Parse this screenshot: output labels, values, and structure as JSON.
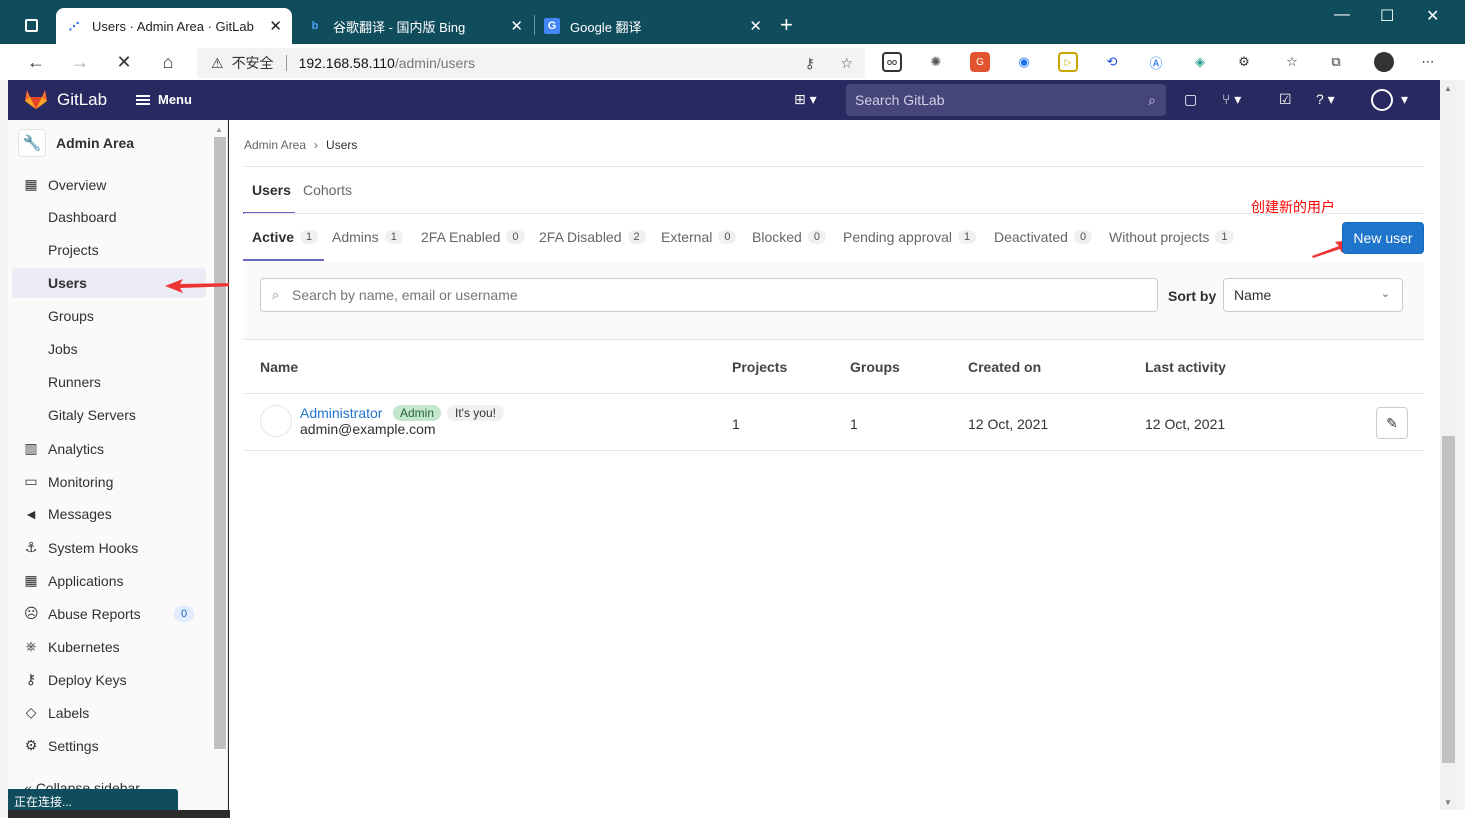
{
  "browser": {
    "tabs": [
      {
        "title": "Users · Admin Area · GitLab",
        "icon": "loading-icon"
      },
      {
        "title": "谷歌翻译 - 国内版 Bing",
        "icon": "bing-icon"
      },
      {
        "title": "Google 翻译",
        "icon": "google-translate-icon"
      }
    ],
    "address": {
      "security": "不安全",
      "host": "192.168.58.110",
      "path": "/admin/users"
    },
    "status": "正在连接..."
  },
  "header": {
    "brand": "GitLab",
    "menu_label": "Menu",
    "search_placeholder": "Search GitLab"
  },
  "sidebar": {
    "title": "Admin Area",
    "overview": "Overview",
    "overview_items": [
      "Dashboard",
      "Projects",
      "Users",
      "Groups",
      "Jobs",
      "Runners",
      "Gitaly Servers"
    ],
    "items": [
      {
        "label": "Analytics",
        "icon": "chart-icon"
      },
      {
        "label": "Monitoring",
        "icon": "monitor-icon"
      },
      {
        "label": "Messages",
        "icon": "megaphone-icon"
      },
      {
        "label": "System Hooks",
        "icon": "hook-icon"
      },
      {
        "label": "Applications",
        "icon": "apps-icon"
      },
      {
        "label": "Abuse Reports",
        "icon": "abuse-icon",
        "count": "0"
      },
      {
        "label": "Kubernetes",
        "icon": "kubernetes-icon"
      },
      {
        "label": "Deploy Keys",
        "icon": "key-icon"
      },
      {
        "label": "Labels",
        "icon": "label-icon"
      },
      {
        "label": "Settings",
        "icon": "settings-icon"
      }
    ],
    "collapse": "Collapse sidebar"
  },
  "main": {
    "breadcrumb": [
      "Admin Area",
      "Users"
    ],
    "top_tabs": [
      "Users",
      "Cohorts"
    ],
    "filter_tabs": [
      {
        "label": "Active",
        "count": "1"
      },
      {
        "label": "Admins",
        "count": "1"
      },
      {
        "label": "2FA Enabled",
        "count": "0"
      },
      {
        "label": "2FA Disabled",
        "count": "2"
      },
      {
        "label": "External",
        "count": "0"
      },
      {
        "label": "Blocked",
        "count": "0"
      },
      {
        "label": "Pending approval",
        "count": "1"
      },
      {
        "label": "Deactivated",
        "count": "0"
      },
      {
        "label": "Without projects",
        "count": "1"
      }
    ],
    "new_user": "New user",
    "annotation": "创建新的用户",
    "search_placeholder": "Search by name, email or username",
    "sort_label": "Sort by",
    "sort_value": "Name",
    "columns": [
      "Name",
      "Projects",
      "Groups",
      "Created on",
      "Last activity"
    ],
    "users": [
      {
        "name": "Administrator",
        "badge_admin": "Admin",
        "badge_you": "It's you!",
        "email": "admin@example.com",
        "projects": "1",
        "groups": "1",
        "created": "12 Oct, 2021",
        "last_activity": "12 Oct, 2021"
      }
    ]
  },
  "colors": {
    "gitlab_header": "#292961",
    "primary": "#1f75cb",
    "annotation": "#ff0000",
    "browser_frame": "#0f4c5c"
  }
}
